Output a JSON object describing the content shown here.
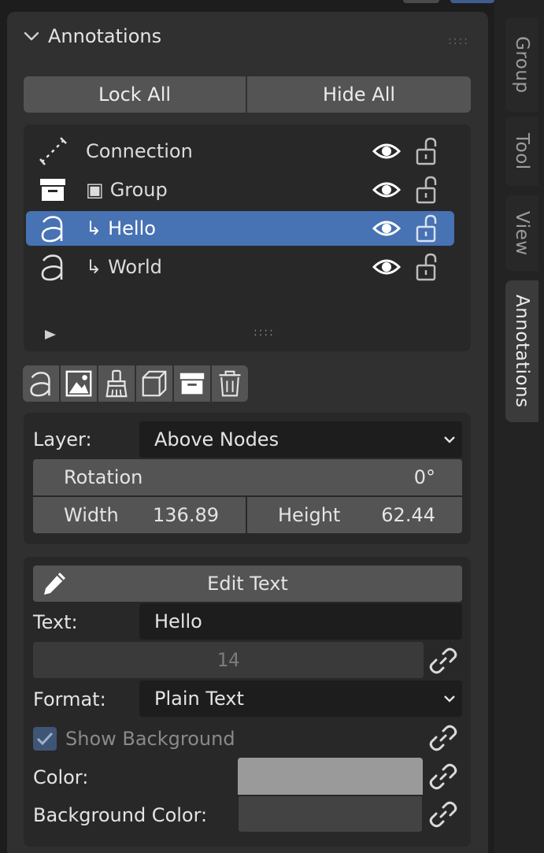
{
  "sidebar_tabs": [
    "Group",
    "Tool",
    "View",
    "Annotations"
  ],
  "panel": {
    "title": "Annotations",
    "lock_all": "Lock All",
    "hide_all": "Hide All",
    "items": [
      {
        "label": "Connection",
        "icon": "connection-icon",
        "prefix": ""
      },
      {
        "label": "Group",
        "icon": "archive-icon",
        "prefix": "▣"
      },
      {
        "label": "Hello",
        "icon": "text-a-icon",
        "prefix": "↳",
        "selected": true
      },
      {
        "label": "World",
        "icon": "text-a-icon",
        "prefix": "↳"
      }
    ],
    "tools": [
      "text-a-icon",
      "image-icon",
      "brush-icon",
      "cube-icon",
      "archive-icon",
      "trash-icon"
    ]
  },
  "transform": {
    "layer_label": "Layer:",
    "layer_value": "Above Nodes",
    "rotation_label": "Rotation",
    "rotation_value": "0°",
    "width_label": "Width",
    "width_value": "136.89",
    "height_label": "Height",
    "height_value": "62.44"
  },
  "text_props": {
    "edit_button": "Edit Text",
    "text_label": "Text:",
    "text_value": "Hello",
    "font_size": "14",
    "format_label": "Format:",
    "format_value": "Plain Text",
    "show_background": "Show Background",
    "color_label": "Color:",
    "color_value": "#9a9a9a",
    "bg_color_label": "Background Color:",
    "bg_color_value": "#434343"
  },
  "colors": {
    "accent": "#4772b3",
    "panel": "#303030",
    "box": "#282828",
    "button": "#545454"
  }
}
